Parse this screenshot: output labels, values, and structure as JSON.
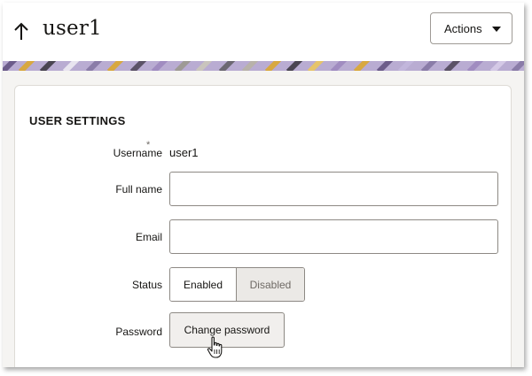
{
  "header": {
    "title": "user1",
    "back_icon": "arrow-up-icon",
    "actions_label": "Actions",
    "actions_icon": "caret-down-icon"
  },
  "section": {
    "title": "USER SETTINGS"
  },
  "fields": {
    "username": {
      "label": "Username",
      "required_mark": "*",
      "value": "user1"
    },
    "full_name": {
      "label": "Full name",
      "value": ""
    },
    "email": {
      "label": "Email",
      "value": ""
    },
    "status": {
      "label": "Status",
      "options": [
        "Enabled",
        "Disabled"
      ],
      "selected": "Enabled"
    },
    "password": {
      "label": "Password",
      "button_label": "Change password"
    }
  },
  "colors": {
    "text": "#161513",
    "border": "#8d8984",
    "disabled_segment_bg": "#ebe9e6",
    "page_bg": "#f5f4f2",
    "banner_purple": "#a08cc0",
    "banner_gold": "#d8a840"
  },
  "cursor": "hand-pointer-icon"
}
